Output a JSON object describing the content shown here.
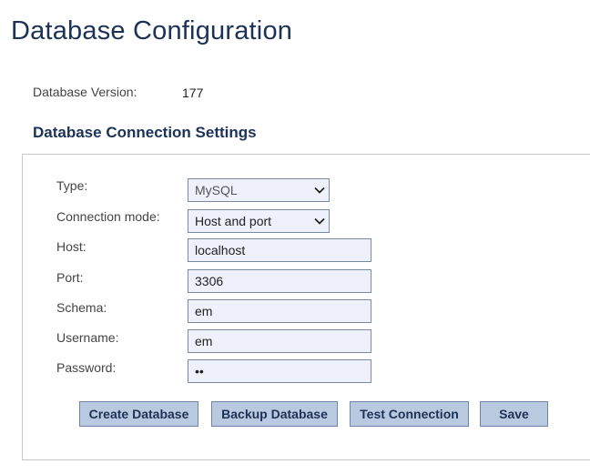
{
  "page": {
    "title": "Database Configuration"
  },
  "version": {
    "label": "Database Version:",
    "value": "177"
  },
  "section": {
    "title": "Database Connection Settings"
  },
  "form": {
    "type": {
      "label": "Type:",
      "value": "MySQL"
    },
    "connection_mode": {
      "label": "Connection mode:",
      "value": "Host and port"
    },
    "host": {
      "label": "Host:",
      "value": "localhost"
    },
    "port": {
      "label": "Port:",
      "value": "3306"
    },
    "schema": {
      "label": "Schema:",
      "value": "em"
    },
    "username": {
      "label": "Username:",
      "value": "em"
    },
    "password": {
      "label": "Password:",
      "value": "••"
    }
  },
  "buttons": {
    "create": "Create Database",
    "backup": "Backup Database",
    "test": "Test Connection",
    "save": "Save"
  },
  "colors": {
    "title": "#1c3256",
    "field_bg": "#eef0fb",
    "button_bg": "#b9c9df",
    "button_border": "#6d86a8"
  },
  "icons": {
    "select_arrow": "chevron-down-icon"
  }
}
